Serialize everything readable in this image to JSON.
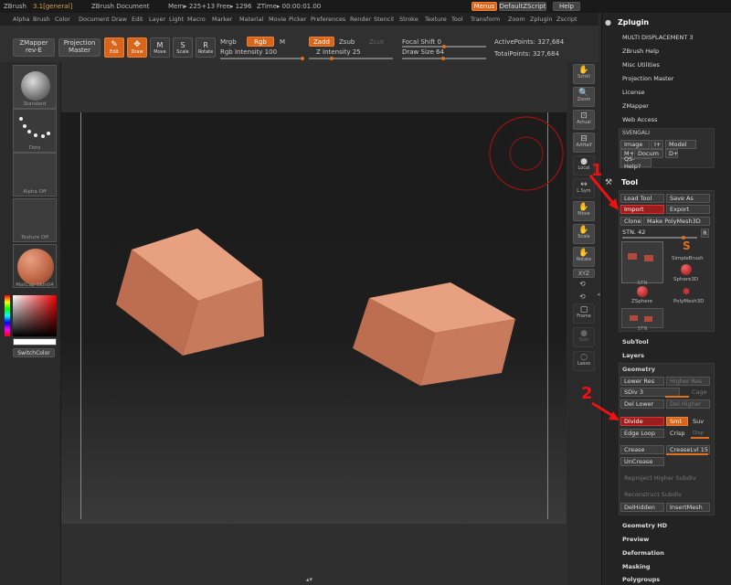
{
  "title": {
    "app": "ZBrush",
    "version": "3.1[general]",
    "doc": "ZBrush Document",
    "mem": "Mem▸ 225+13",
    "free": "Free▸ 1296",
    "ztime": "ZTime▸ 00:00:01.00",
    "menus": "Menus",
    "default_zscript": "DefaultZScript",
    "help": "Help"
  },
  "menu": [
    "Alpha",
    "Brush",
    "Color",
    "Document",
    "Draw",
    "Edit",
    "Layer",
    "Light",
    "Macro",
    "Marker",
    "Material",
    "Movie",
    "Picker",
    "Preferences",
    "Render",
    "Stencil",
    "Stroke",
    "Texture",
    "Tool",
    "Transform",
    "Zoom",
    "Zplugin",
    "Zscript"
  ],
  "toolbar": {
    "zmapper": "ZMapper",
    "zmapper_rev": "rev-E",
    "projection": "Projection",
    "master": "Master",
    "edit": "Edit",
    "draw": "Draw",
    "move": "Move",
    "scale": "Scale",
    "rotate": "Rotate",
    "mrgb": "Mrgb",
    "rgb": "Rgb",
    "m": "M",
    "rgb_intensity": "Rgb Intensity 100",
    "zadd": "Zadd",
    "zsub": "Zsub",
    "zcut": "Zcut",
    "z_intensity": "Z Intensity 25",
    "focal_shift": "Focal Shift 0",
    "draw_size": "Draw Size 64",
    "active_points": "ActivePoints: 327,684",
    "total_points": "TotalPoints: 327,684"
  },
  "left": {
    "standard": "Standard",
    "dots": "Dots",
    "alpha_off": "Alpha Off",
    "texture_off": "Texture Off",
    "matcap": "MatCap Skin04",
    "switch_color": "SwitchColor"
  },
  "right_shelf": [
    "Scroll",
    "Zoom",
    "Actual",
    "AAHalf",
    "Local",
    "L.Sym",
    "Move",
    "Scale",
    "Rotate",
    "XYZ",
    "Frame",
    "Solo",
    "Lasso"
  ],
  "zplugin": {
    "title": "Zplugin",
    "items": [
      "MULTI DISPLACEMENT 3",
      "ZBrush Help",
      "Misc Utilities",
      "Projection Master",
      "License",
      "ZMapper",
      "Web Access"
    ],
    "svengali": "SVENGALI",
    "image": "Image",
    "iplus": "I+",
    "model": "Model",
    "mplus": "M+",
    "docum": "Docum",
    "dplus": "D+",
    "qshelp": "QS-Help?"
  },
  "tool": {
    "title": "Tool",
    "load": "Load Tool",
    "save": "Save As",
    "import": "Import",
    "export": "Export",
    "clone": "Clone",
    "make_poly": "Make PolyMesh3D",
    "stn": "STN. 42",
    "r": "R",
    "stn_small": "STN",
    "simplebrush": "SimpleBrush",
    "sphere3d": "Sphere3D",
    "zsphere": "ZSphere",
    "polymesh": "PolyMesh3D",
    "subtool": "SubTool",
    "layers": "Layers",
    "geometry": "Geometry",
    "lower_res": "Lower Res",
    "higher_res": "Higher Res",
    "sdiv": "SDiv 3",
    "cage": "Cage",
    "del_lower": "Del Lower",
    "del_higher": "Del Higher",
    "divide": "Divide",
    "smt": "Smt",
    "suv": "Suv",
    "edge_loop": "Edge Loop",
    "crisp": "Crisp",
    "disp": "Disp",
    "crease": "Crease",
    "crease_lvl": "CreaseLvl 15",
    "uncrease": "UnCrease",
    "reproject": "Reproject Higher Subdiv",
    "reconstruct": "Reconstruct Subdiv",
    "del_hidden": "DelHidden",
    "insert_mesh": "InsertMesh",
    "geometry_hd": "Geometry HD",
    "preview": "Preview",
    "deformation": "Deformation",
    "masking": "Masking",
    "polygroups": "Polygroups"
  },
  "annotations": {
    "one": "1",
    "two": "2"
  }
}
